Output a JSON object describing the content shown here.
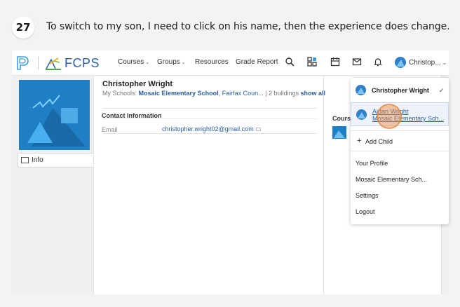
{
  "step": {
    "number": "27",
    "instruction": "To switch to my son, I need to click on his name, then the experience does change."
  },
  "nav": {
    "brand": "FCPS",
    "items": [
      {
        "label": "Courses",
        "has_menu": true
      },
      {
        "label": "Groups",
        "has_menu": true
      },
      {
        "label": "Resources",
        "has_menu": false
      },
      {
        "label": "Grade Report",
        "has_menu": false
      }
    ],
    "user_label": "Christop..."
  },
  "profile": {
    "name": "Christopher Wright",
    "schools_prefix": "My Schools: ",
    "school_primary": "Mosaic Elementary School",
    "school_secondary": ", Fairfax Coun...",
    "buildings": " | 2 buildings ",
    "show_all": "show all",
    "tab_info": "Info",
    "contact_title": "Contact Information",
    "email_label": "Email",
    "email_value": "christopher.wright02@gmail.com",
    "courses_label": "Course"
  },
  "dropdown": {
    "current_user": "Christopher Wright",
    "current_check": "✓",
    "child_name": "Aidan Wright",
    "child_school": "Mosaic Elementary Sch...",
    "add_child": "Add Child",
    "add_child_icon": "+",
    "your_profile": "Your Profile",
    "school": "Mosaic Elementary Sch...",
    "settings": "Settings",
    "logout": "Logout"
  },
  "colors": {
    "brand_blue": "#2a62a8",
    "avatar_blue": "#2f7fc9",
    "highlight": "#f08c3c"
  }
}
